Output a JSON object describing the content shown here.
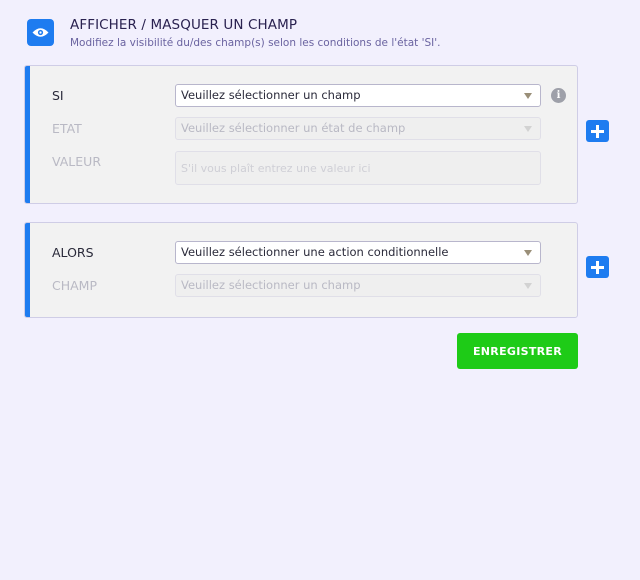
{
  "header": {
    "title": "AFFICHER / MASQUER UN CHAMP",
    "subtitle": "Modifiez la visibilité du/des champ(s) selon les conditions de l'état 'SI'."
  },
  "condition_card": {
    "si_label": "SI",
    "si_select_value": "Veuillez sélectionner un champ",
    "etat_label": "ETAT",
    "etat_select_value": "Veuillez sélectionner un état de champ",
    "valeur_label": "VALEUR",
    "valeur_placeholder": "S'il vous plaît entrez une valeur ici",
    "info_glyph": "i"
  },
  "action_card": {
    "alors_label": "ALORS",
    "alors_select_value": "Veuillez sélectionner une action conditionnelle",
    "champ_label": "CHAMP",
    "champ_select_value": "Veuillez sélectionner un champ"
  },
  "actions": {
    "save_label": "ENREGISTRER"
  },
  "icons": {
    "header": "eye-icon",
    "info": "info-icon",
    "add": "plus-icon"
  },
  "colors": {
    "accent_blue": "#1e7cf0",
    "save_green": "#1ecb17",
    "background": "#f2f0fd"
  }
}
